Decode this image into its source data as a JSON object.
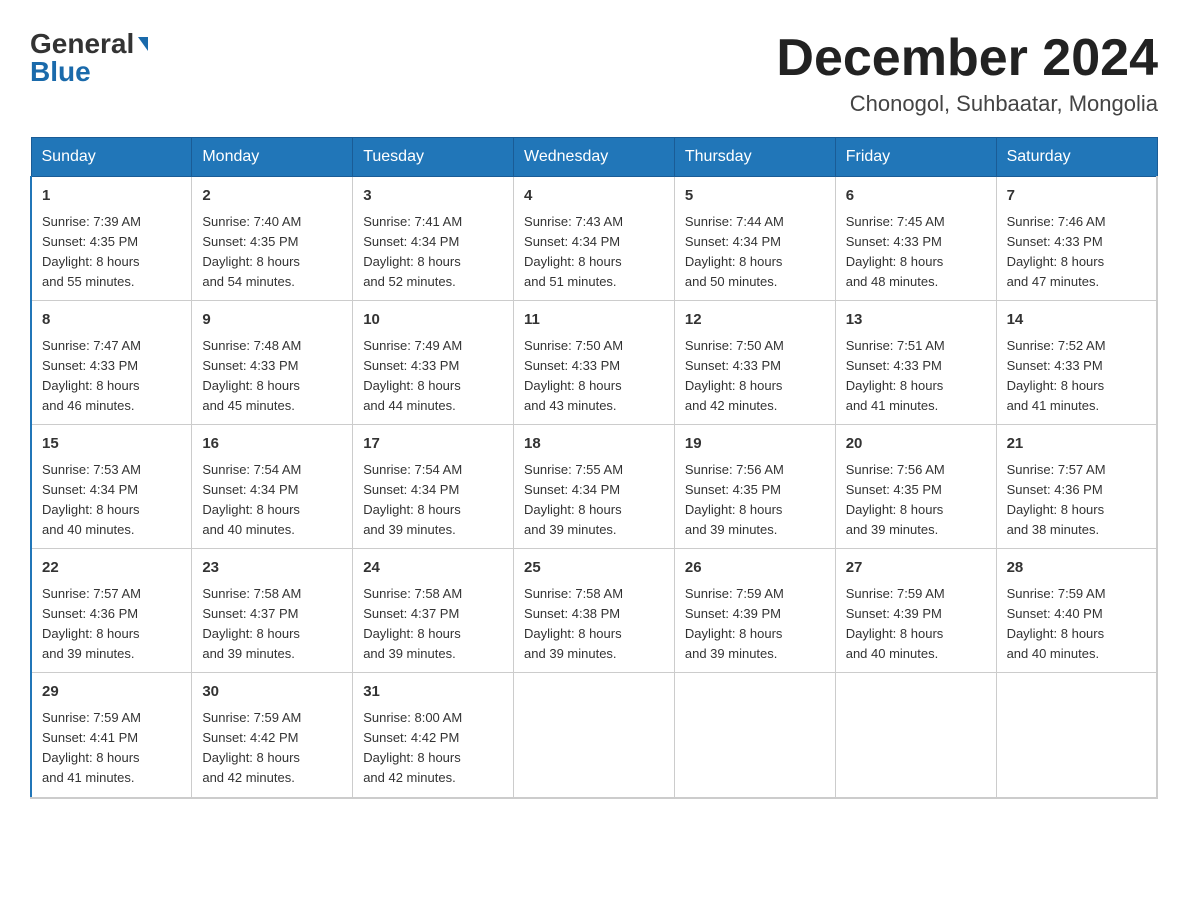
{
  "header": {
    "logo_general": "General",
    "logo_blue": "Blue",
    "month_title": "December 2024",
    "location": "Chonogol, Suhbaatar, Mongolia"
  },
  "weekdays": [
    "Sunday",
    "Monday",
    "Tuesday",
    "Wednesday",
    "Thursday",
    "Friday",
    "Saturday"
  ],
  "weeks": [
    [
      {
        "day": "1",
        "sunrise": "7:39 AM",
        "sunset": "4:35 PM",
        "daylight": "8 hours and 55 minutes."
      },
      {
        "day": "2",
        "sunrise": "7:40 AM",
        "sunset": "4:35 PM",
        "daylight": "8 hours and 54 minutes."
      },
      {
        "day": "3",
        "sunrise": "7:41 AM",
        "sunset": "4:34 PM",
        "daylight": "8 hours and 52 minutes."
      },
      {
        "day": "4",
        "sunrise": "7:43 AM",
        "sunset": "4:34 PM",
        "daylight": "8 hours and 51 minutes."
      },
      {
        "day": "5",
        "sunrise": "7:44 AM",
        "sunset": "4:34 PM",
        "daylight": "8 hours and 50 minutes."
      },
      {
        "day": "6",
        "sunrise": "7:45 AM",
        "sunset": "4:33 PM",
        "daylight": "8 hours and 48 minutes."
      },
      {
        "day": "7",
        "sunrise": "7:46 AM",
        "sunset": "4:33 PM",
        "daylight": "8 hours and 47 minutes."
      }
    ],
    [
      {
        "day": "8",
        "sunrise": "7:47 AM",
        "sunset": "4:33 PM",
        "daylight": "8 hours and 46 minutes."
      },
      {
        "day": "9",
        "sunrise": "7:48 AM",
        "sunset": "4:33 PM",
        "daylight": "8 hours and 45 minutes."
      },
      {
        "day": "10",
        "sunrise": "7:49 AM",
        "sunset": "4:33 PM",
        "daylight": "8 hours and 44 minutes."
      },
      {
        "day": "11",
        "sunrise": "7:50 AM",
        "sunset": "4:33 PM",
        "daylight": "8 hours and 43 minutes."
      },
      {
        "day": "12",
        "sunrise": "7:50 AM",
        "sunset": "4:33 PM",
        "daylight": "8 hours and 42 minutes."
      },
      {
        "day": "13",
        "sunrise": "7:51 AM",
        "sunset": "4:33 PM",
        "daylight": "8 hours and 41 minutes."
      },
      {
        "day": "14",
        "sunrise": "7:52 AM",
        "sunset": "4:33 PM",
        "daylight": "8 hours and 41 minutes."
      }
    ],
    [
      {
        "day": "15",
        "sunrise": "7:53 AM",
        "sunset": "4:34 PM",
        "daylight": "8 hours and 40 minutes."
      },
      {
        "day": "16",
        "sunrise": "7:54 AM",
        "sunset": "4:34 PM",
        "daylight": "8 hours and 40 minutes."
      },
      {
        "day": "17",
        "sunrise": "7:54 AM",
        "sunset": "4:34 PM",
        "daylight": "8 hours and 39 minutes."
      },
      {
        "day": "18",
        "sunrise": "7:55 AM",
        "sunset": "4:34 PM",
        "daylight": "8 hours and 39 minutes."
      },
      {
        "day": "19",
        "sunrise": "7:56 AM",
        "sunset": "4:35 PM",
        "daylight": "8 hours and 39 minutes."
      },
      {
        "day": "20",
        "sunrise": "7:56 AM",
        "sunset": "4:35 PM",
        "daylight": "8 hours and 39 minutes."
      },
      {
        "day": "21",
        "sunrise": "7:57 AM",
        "sunset": "4:36 PM",
        "daylight": "8 hours and 38 minutes."
      }
    ],
    [
      {
        "day": "22",
        "sunrise": "7:57 AM",
        "sunset": "4:36 PM",
        "daylight": "8 hours and 39 minutes."
      },
      {
        "day": "23",
        "sunrise": "7:58 AM",
        "sunset": "4:37 PM",
        "daylight": "8 hours and 39 minutes."
      },
      {
        "day": "24",
        "sunrise": "7:58 AM",
        "sunset": "4:37 PM",
        "daylight": "8 hours and 39 minutes."
      },
      {
        "day": "25",
        "sunrise": "7:58 AM",
        "sunset": "4:38 PM",
        "daylight": "8 hours and 39 minutes."
      },
      {
        "day": "26",
        "sunrise": "7:59 AM",
        "sunset": "4:39 PM",
        "daylight": "8 hours and 39 minutes."
      },
      {
        "day": "27",
        "sunrise": "7:59 AM",
        "sunset": "4:39 PM",
        "daylight": "8 hours and 40 minutes."
      },
      {
        "day": "28",
        "sunrise": "7:59 AM",
        "sunset": "4:40 PM",
        "daylight": "8 hours and 40 minutes."
      }
    ],
    [
      {
        "day": "29",
        "sunrise": "7:59 AM",
        "sunset": "4:41 PM",
        "daylight": "8 hours and 41 minutes."
      },
      {
        "day": "30",
        "sunrise": "7:59 AM",
        "sunset": "4:42 PM",
        "daylight": "8 hours and 42 minutes."
      },
      {
        "day": "31",
        "sunrise": "8:00 AM",
        "sunset": "4:42 PM",
        "daylight": "8 hours and 42 minutes."
      },
      null,
      null,
      null,
      null
    ]
  ],
  "labels": {
    "sunrise_prefix": "Sunrise: ",
    "sunset_prefix": "Sunset: ",
    "daylight_prefix": "Daylight: "
  }
}
